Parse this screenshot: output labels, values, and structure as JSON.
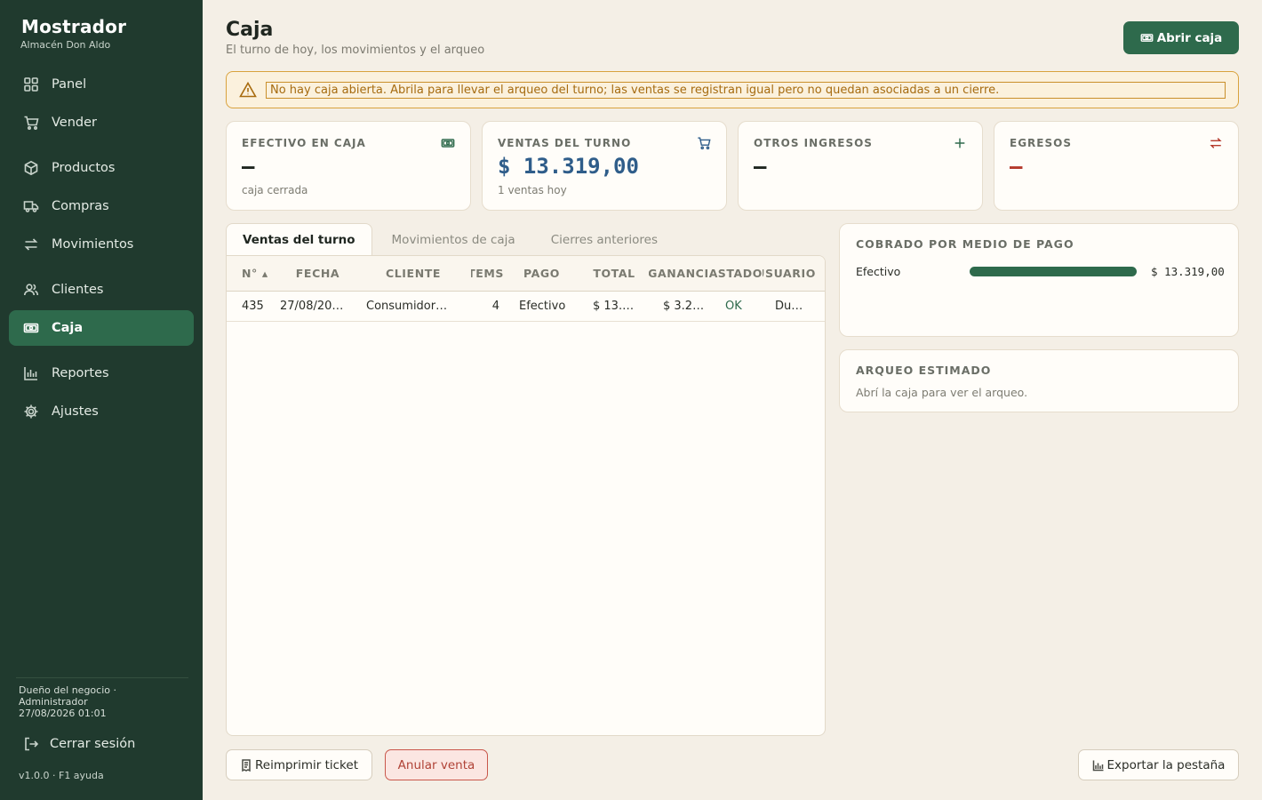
{
  "sidebar": {
    "brand_title": "Mostrador",
    "brand_sub": "Almacén Don Aldo",
    "items": [
      {
        "label": "Panel",
        "icon": "grid-icon"
      },
      {
        "label": "Vender",
        "icon": "cart-icon"
      },
      {
        "label": "Productos",
        "icon": "box-icon"
      },
      {
        "label": "Compras",
        "icon": "truck-icon"
      },
      {
        "label": "Movimientos",
        "icon": "swap-icon"
      },
      {
        "label": "Clientes",
        "icon": "users-icon"
      },
      {
        "label": "Caja",
        "icon": "cash-icon"
      },
      {
        "label": "Reportes",
        "icon": "bar-chart-icon"
      },
      {
        "label": "Ajustes",
        "icon": "gear-icon"
      }
    ],
    "active_item": "Caja",
    "user_role": "Dueño del negocio  ·",
    "user_name": "Administrador",
    "user_datetime": "27/08/2026  01:01",
    "logout_label": "Cerrar sesión",
    "version": "v1.0.0  ·  F1 ayuda"
  },
  "header": {
    "title": "Caja",
    "subtitle": "El turno de hoy, los movimientos y el arqueo",
    "open_button": "Abrir caja"
  },
  "alert": {
    "text": "No hay caja abierta. Abrila para llevar el arqueo del turno; las ventas se registran igual pero no quedan asociadas a un cierre."
  },
  "stats": [
    {
      "label": "EFECTIVO EN CAJA",
      "value": "—",
      "foot": "caja cerrada",
      "icon": "cash-icon",
      "color": "#1f2620"
    },
    {
      "label": "VENTAS DEL TURNO",
      "value": "$ 13.319,00",
      "foot": "1 ventas hoy",
      "icon": "cart-icon",
      "color": "#2f5d8a"
    },
    {
      "label": "OTROS INGRESOS",
      "value": "—",
      "foot": "",
      "icon": "plus-icon",
      "color": "#1f2620"
    },
    {
      "label": "EGRESOS",
      "value": "—",
      "foot": "",
      "icon": "swap-icon",
      "color": "#b5392c"
    }
  ],
  "tabs": [
    "Ventas del turno",
    "Movimientos de caja",
    "Cierres anteriores"
  ],
  "table": {
    "columns": [
      "N° ▴",
      "FECHA",
      "CLIENTE",
      "ÍTEMS",
      "PAGO",
      "TOTAL",
      "GANANCIA",
      "ESTADO",
      "USUARIO"
    ],
    "rows": [
      [
        "435",
        "27/08/20…",
        "Consumidor…",
        "4",
        "Efectivo",
        "$  13.…",
        "$  3.2…",
        "OK",
        "Du…"
      ]
    ]
  },
  "payment_card": {
    "title": "COBRADO POR MEDIO DE PAGO",
    "method": "Efectivo",
    "share": 1.0,
    "amount": "$ 13.319,00"
  },
  "arqueo_card": {
    "title": "ARQUEO ESTIMADO",
    "text": "Abrí la caja para ver el arqueo."
  },
  "footer_buttons": {
    "reprint": "Reimprimir ticket",
    "void": "Anular venta",
    "export": "Exportar la pestaña"
  },
  "colors": {
    "sidebar_bg": "#203a2e",
    "accent": "#2e6a4c",
    "warning": "#d9a23d",
    "danger": "#b5392c"
  }
}
